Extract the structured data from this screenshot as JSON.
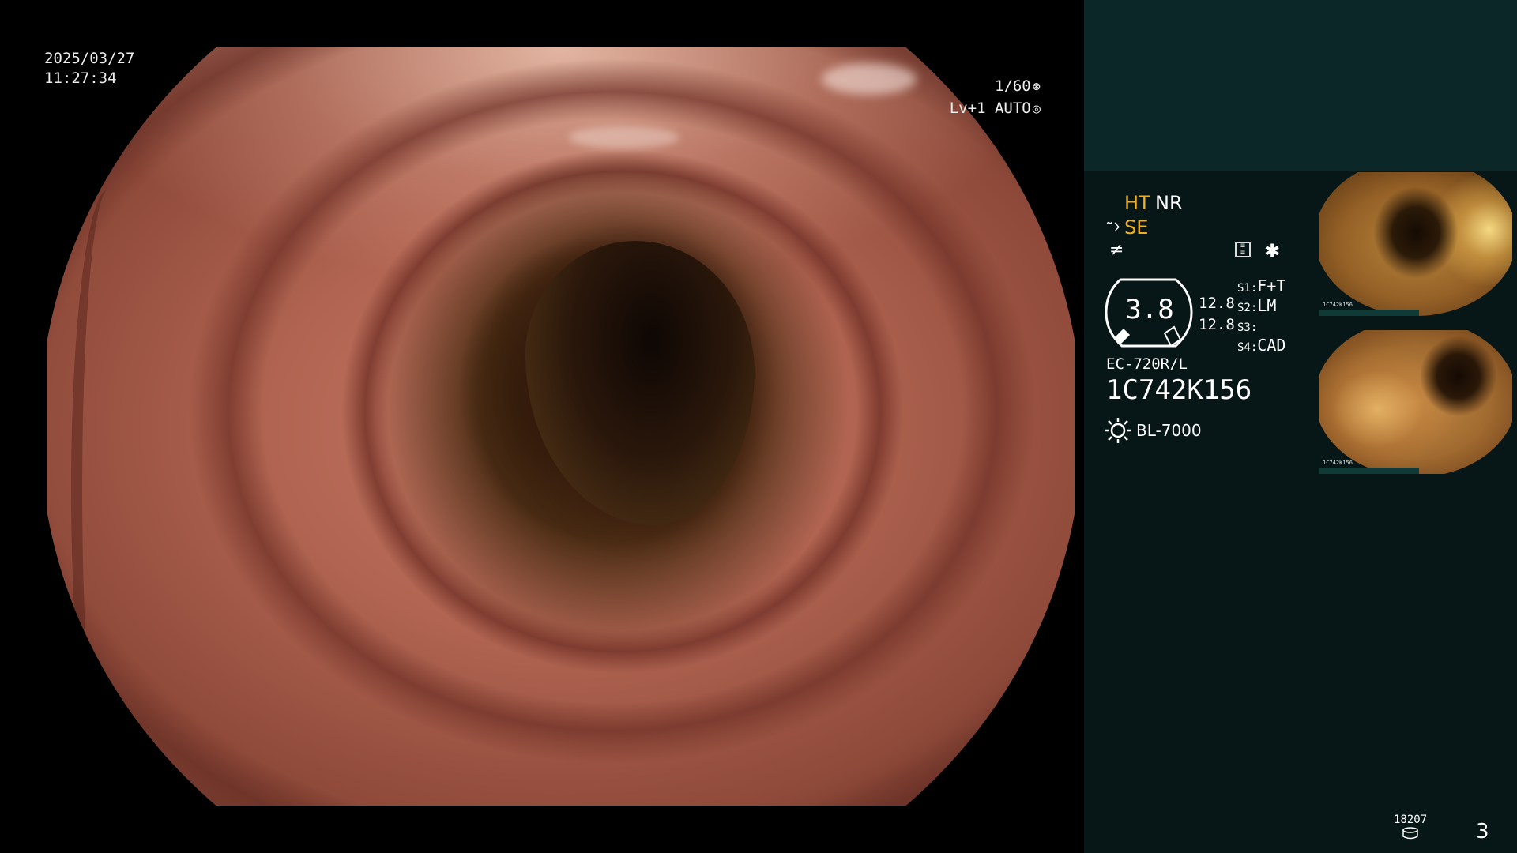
{
  "overlay": {
    "date": "2025/03/27",
    "time": "11:27:34",
    "shutter": "1/60",
    "level": "Lv+1",
    "iris_mode": "AUTO"
  },
  "panel": {
    "ht": "HT",
    "nr": "NR",
    "se": "SE",
    "gauge_value": "3.8",
    "gauge_right_1": "12.8",
    "gauge_right_2": "12.8",
    "switches": [
      {
        "key": "S1:",
        "value": "F+T"
      },
      {
        "key": "S2:",
        "value": "LM"
      },
      {
        "key": "S3:",
        "value": ""
      },
      {
        "key": "S4:",
        "value": "CAD"
      }
    ],
    "scope_model": "EC-720R/L",
    "serial": "1C742K156",
    "light_source": "BL-7000",
    "counter": "18207",
    "page_number": "3"
  },
  "colors": {
    "accent_orange": "#f0b020",
    "panel_top": "#0c2727",
    "panel_main": "#071616"
  },
  "icons": [
    "shutter-icon",
    "iris-icon",
    "structure-enhance-icon",
    "freeze-icon",
    "memory-icon",
    "lamp-icon",
    "storage-icon"
  ]
}
